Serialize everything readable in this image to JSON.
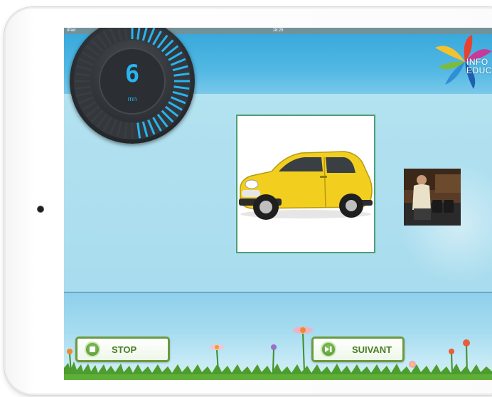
{
  "status_bar": {
    "carrier": "iPad",
    "time": "18:29"
  },
  "timer": {
    "value": "6",
    "unit": "mn",
    "progress": 0.5
  },
  "logo": {
    "line1": "INFO",
    "line2": "EDUCA"
  },
  "buttons": {
    "stop": "STOP",
    "next": "SUIVANT"
  },
  "icons": {
    "stop": "stop-icon",
    "next": "skip-forward-icon",
    "logo": "pinwheel-logo-icon"
  },
  "colors": {
    "timer_accent": "#27b5ef",
    "button_border": "#6a9b3f",
    "button_text": "#4a7d25",
    "card_border": "#4f9f73",
    "header_blue": "#39a9dc"
  }
}
